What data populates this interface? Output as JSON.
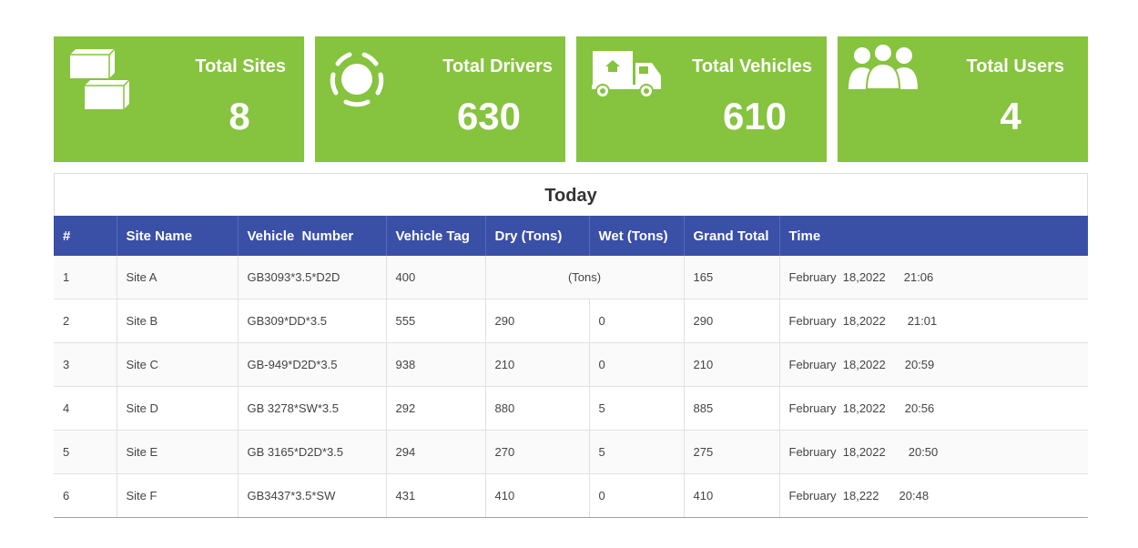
{
  "cards": [
    {
      "title": "Total Sites",
      "value": "8",
      "icon": "stacked-boxes-icon"
    },
    {
      "title": "Total Drivers",
      "value": "630",
      "icon": "loading-circle-icon"
    },
    {
      "title": "Total Vehicles",
      "value": "610",
      "icon": "delivery-truck-icon"
    },
    {
      "title": "Total Users",
      "value": "4",
      "icon": "user-group-icon"
    }
  ],
  "table": {
    "title": "Today",
    "headers": [
      "#",
      "Site Name",
      "Vehicle  Number",
      "Vehicle Tag",
      "Dry (Tons)",
      "Wet (Tons)",
      "Grand Total",
      "Time"
    ],
    "rows": [
      {
        "num": "1",
        "site": "Site A",
        "vehicle": "GB3093*3.5*D2D",
        "tag": "400",
        "merged": "(Tons)",
        "total": "165",
        "date": "February  18,2022",
        "time": "21:06"
      },
      {
        "num": "2",
        "site": "Site B",
        "vehicle": "GB309*DD*3.5",
        "tag": "555",
        "dry": "290",
        "wet": "0",
        "total": "290",
        "date": "February  18,2022",
        "time": "21:01"
      },
      {
        "num": "3",
        "site": "Site C",
        "vehicle": "GB-949*D2D*3.5",
        "tag": "938",
        "dry": "210",
        "wet": "0",
        "total": "210",
        "date": "February  18,2022",
        "time": "20:59"
      },
      {
        "num": "4",
        "site": "Site D",
        "vehicle": "GB 3278*SW*3.5",
        "tag": "292",
        "dry": "880",
        "wet": "5",
        "total": "885",
        "date": "February  18,2022",
        "time": "20:56"
      },
      {
        "num": "5",
        "site": "Site E",
        "vehicle": "GB 3165*D2D*3.5",
        "tag": "294",
        "dry": "270",
        "wet": "5",
        "total": "275",
        "date": "February  18,2022",
        "time": "20:50"
      },
      {
        "num": "6",
        "site": "Site F",
        "vehicle": "GB3437*3.5*SW",
        "tag": "431",
        "dry": "410",
        "wet": "0",
        "total": "410",
        "date": "February  18,222",
        "time": "20:48"
      }
    ]
  },
  "colors": {
    "card_bg": "#86c33e",
    "header_bg": "#3a4fa6"
  }
}
